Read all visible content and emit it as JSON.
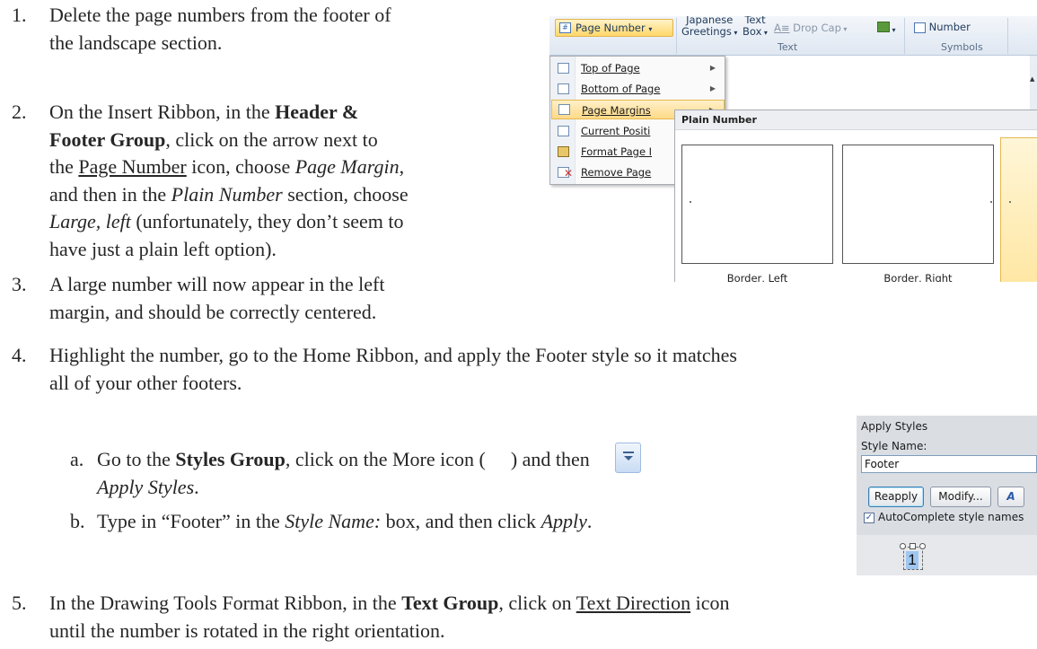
{
  "steps": [
    {
      "num": "1.",
      "line1": "Delete the page numbers from the footer of",
      "line2": "the landscape section."
    },
    {
      "num": "2.",
      "l1_a": "On the Insert Ribbon, in the ",
      "l1_b": "Header &",
      "l2_a": "Footer Group",
      "l2_b": ", click on the arrow next to",
      "l3_a": "the ",
      "l3_b": "Page Number",
      "l3_c": " icon, choose ",
      "l3_d": "Page Margin",
      "l3_e": ",",
      "l4_a": "and then in the ",
      "l4_b": "Plain Number",
      "l4_c": " section, choose",
      "l5_a": "Large, left",
      "l5_b": " (unfortunately, they don’t seem to",
      "l6": "have just a plain left option)."
    },
    {
      "num": "3.",
      "line1": "A large number will now appear in the left",
      "line2": "margin, and should be correctly centered."
    },
    {
      "num": "4.",
      "line1": "Highlight the number, go to the Home Ribbon, and apply the Footer style so it matches",
      "line2": "all of your other footers."
    },
    {
      "num": "5.",
      "l1_a": "In the Drawing Tools Format Ribbon, in the ",
      "l1_b": "Text Group",
      "l1_c": ", click on ",
      "l1_d": "Text Direction",
      "l1_e": " icon",
      "line2": "until the number is rotated in the right orientation."
    }
  ],
  "substeps": [
    {
      "letter": "a.",
      "a": "Go to the ",
      "b": "Styles Group",
      "c": ", click on the More icon (",
      "d": ") and then",
      "e": "Apply Styles",
      "f": "."
    },
    {
      "letter": "b.",
      "a": "Type in “Footer” in the ",
      "b": "Style Name:",
      "c": " box, and then click ",
      "d": "Apply",
      "e": "."
    }
  ],
  "ribbon": {
    "page_number_button": "Page Number",
    "japanese_greetings_1": "Japanese",
    "japanese_greetings_2": "Greetings",
    "text_box_1": "Text",
    "text_box_2": "Box",
    "drop_cap": "Drop Cap",
    "number": "Number",
    "group_text": "Text",
    "group_symbols": "Symbols",
    "menu": [
      {
        "label": "Top of Page",
        "has_arrow": true
      },
      {
        "label": "Bottom of Page",
        "has_arrow": true
      },
      {
        "label": "Page Margins",
        "has_arrow": true
      },
      {
        "label": "Current Positi",
        "has_arrow": false
      },
      {
        "label": "Format Page I",
        "has_arrow": false
      },
      {
        "label": "Remove Page",
        "has_arrow": false
      }
    ],
    "gallery_header": "Plain Number",
    "thumb_labels": [
      "Border, Left",
      "Border, Right"
    ]
  },
  "apply_styles": {
    "title": "Apply Styles",
    "label": "Style Name:",
    "field_value": "Footer",
    "reapply": "Reapply",
    "modify": "Modify...",
    "extra_button": "A",
    "checkbox_label": "AutoComplete style names",
    "checkbox_checked": true,
    "number": "1"
  },
  "colors": {
    "text": "#262626",
    "highlight": "#ffd987",
    "ribbon_text": "#1e395b",
    "selected_number": "#9fc7ef"
  }
}
